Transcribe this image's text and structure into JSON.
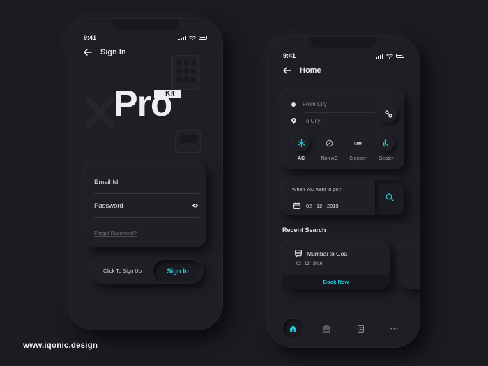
{
  "colors": {
    "background": "#1b1c22",
    "surface": "#1f2026",
    "accent": "#29c4d8",
    "text": "#e8e9ee"
  },
  "signin_screen": {
    "status_time": "9:41",
    "title": "Sign In",
    "logo": {
      "word": "Pro",
      "badge": "Kit"
    },
    "email_placeholder": "Email Id",
    "password_placeholder": "Password",
    "forgot_password": "Forgot Password?",
    "signup_prompt": "Click To Sign Up",
    "signin_button": "Sign In"
  },
  "home_screen": {
    "status_time": "9:41",
    "title": "Home",
    "from_placeholder": "From City",
    "to_placeholder": "To City",
    "bus_types": [
      {
        "label": "AC",
        "icon": "snowflake-icon",
        "active": true
      },
      {
        "label": "Non AC",
        "icon": "no-ac-icon",
        "active": false
      },
      {
        "label": "Sleeper",
        "icon": "bed-icon",
        "active": false
      },
      {
        "label": "Seater",
        "icon": "seat-icon",
        "active": false
      }
    ],
    "date_question": "When You went to  go?",
    "date_value": "02 - 12 - 2019",
    "recent_search_title": "Recent Search",
    "recent": {
      "route": "Mumbai to Goa",
      "date": "02 - 12 - 2019",
      "action": "Book Now"
    },
    "tabs": [
      "home-icon",
      "briefcase-icon",
      "document-icon",
      "more-icon"
    ]
  },
  "footer": "www.iqonic.design"
}
